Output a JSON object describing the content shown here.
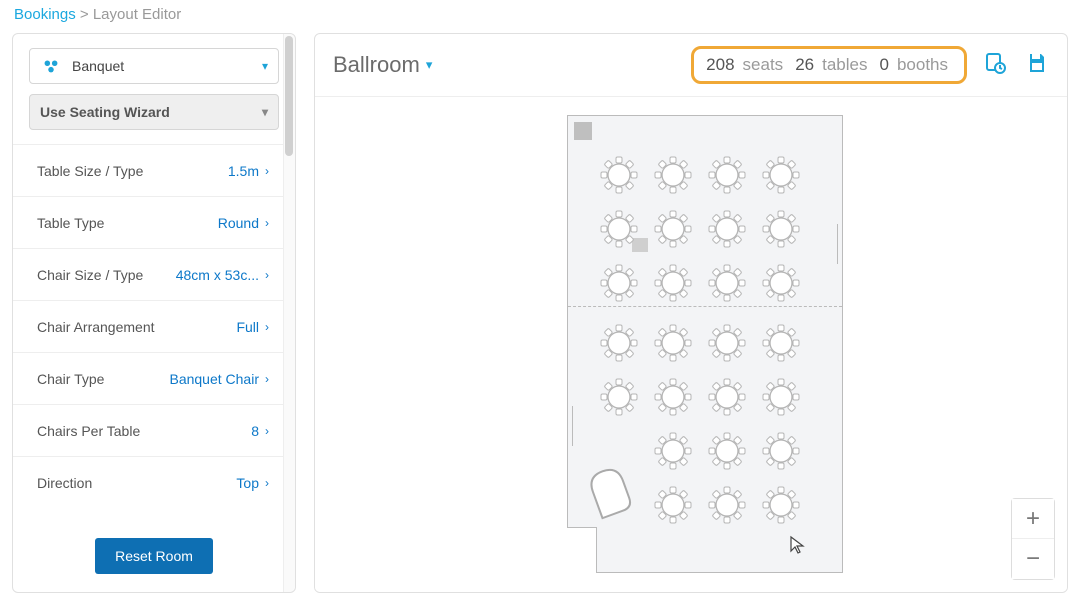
{
  "breadcrumb": {
    "root": "Bookings",
    "current": "Layout Editor"
  },
  "sidebar": {
    "style_label": "Banquet",
    "wizard_label": "Use Seating Wizard",
    "rows": [
      {
        "label": "Table Size / Type",
        "value": "1.5m"
      },
      {
        "label": "Table Type",
        "value": "Round"
      },
      {
        "label": "Chair Size / Type",
        "value": "48cm x 53c..."
      },
      {
        "label": "Chair Arrangement",
        "value": "Full"
      },
      {
        "label": "Chair Type",
        "value": "Banquet Chair"
      },
      {
        "label": "Chairs Per Table",
        "value": "8"
      },
      {
        "label": "Direction",
        "value": "Top"
      }
    ],
    "reset_label": "Reset Room"
  },
  "header": {
    "room_name": "Ballroom",
    "stats": {
      "seats": 208,
      "tables": 26,
      "booths": 0
    },
    "stat_labels": {
      "seats": "seats",
      "tables": "tables",
      "booths": "booths"
    }
  },
  "layout": {
    "cols_x": [
      32,
      86,
      140,
      194
    ],
    "top_rows_y": [
      40,
      94,
      148
    ],
    "bot_rows_y": [
      208,
      262,
      316,
      370
    ],
    "bottom_skip_col0": [
      2,
      3
    ]
  }
}
